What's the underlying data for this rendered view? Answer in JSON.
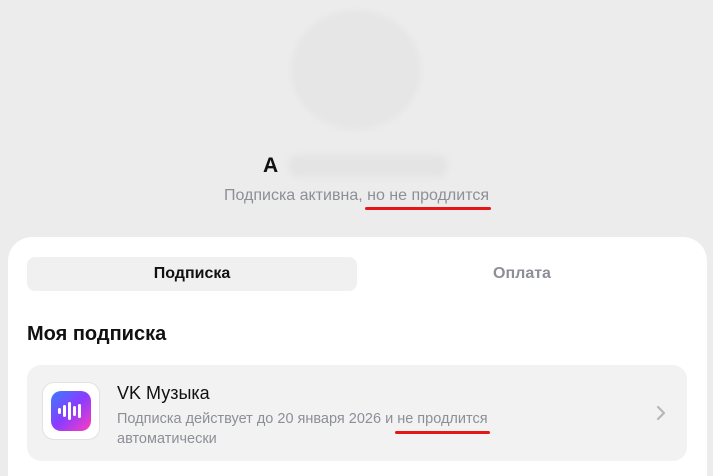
{
  "profile": {
    "name_initial": "А",
    "status_prefix": "Подписка активна, ",
    "status_highlight": "но не продлится"
  },
  "tabs": [
    {
      "label": "Подписка",
      "active": true
    },
    {
      "label": "Оплата",
      "active": false
    }
  ],
  "section": {
    "title": "Моя подписка"
  },
  "subscription": {
    "name": "VK Музыка",
    "desc_prefix": "Подписка действует до 20 января 2026 и ",
    "desc_highlight": "не продлится",
    "desc_suffix": "автоматически",
    "icon": "vk-music-icon"
  },
  "colors": {
    "accent_underline": "#e51616",
    "muted_text": "#8c8f96"
  }
}
